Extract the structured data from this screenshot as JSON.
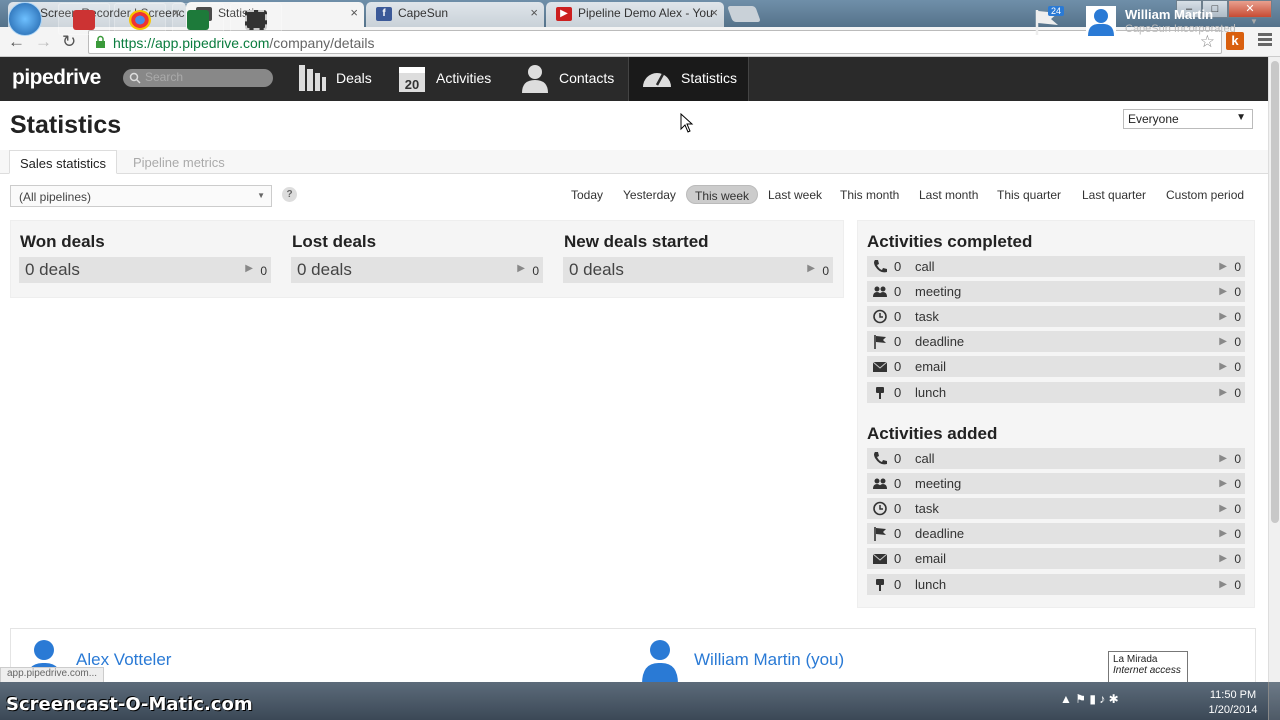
{
  "browser": {
    "tabs": [
      {
        "title": "Screen Recorder | Screenc",
        "favicon": "som-icon",
        "color": "#335577"
      },
      {
        "title": "Statistics",
        "favicon": "pipedrive-icon",
        "color": "#333333"
      },
      {
        "title": "CapeSun",
        "favicon": "facebook-icon",
        "color": "#3b5998"
      },
      {
        "title": "Pipeline Demo Alex - You",
        "favicon": "youtube-icon",
        "color": "#cc1f1f"
      }
    ],
    "url_host": "https://app.pipedrive.com",
    "url_path": "/company/details",
    "extension_letter": "k"
  },
  "app": {
    "logo": "pipedrive",
    "search_placeholder": "Search",
    "nav": [
      {
        "label": "Deals",
        "icon": "deals-icon"
      },
      {
        "label": "Activities",
        "icon": "calendar-icon",
        "badge": "20"
      },
      {
        "label": "Contacts",
        "icon": "contacts-icon"
      },
      {
        "label": "Statistics",
        "icon": "speedometer-icon"
      }
    ],
    "notifications_count": "24",
    "user": {
      "name": "William Martin",
      "company": "CapeSun Incorporated"
    }
  },
  "page": {
    "title": "Statistics",
    "user_filter": "Everyone",
    "tabs": [
      "Sales statistics",
      "Pipeline metrics"
    ],
    "pipeline_select": "(All pipelines)",
    "help": "?",
    "periods": [
      "Today",
      "Yesterday",
      "This week",
      "Last week",
      "This month",
      "Last month",
      "This quarter",
      "Last quarter",
      "Custom period"
    ],
    "active_period": "This week"
  },
  "deal_stats": [
    {
      "title": "Won deals",
      "value": "0 deals",
      "count": "0"
    },
    {
      "title": "Lost deals",
      "value": "0 deals",
      "count": "0"
    },
    {
      "title": "New deals started",
      "value": "0 deals",
      "count": "0"
    }
  ],
  "activities_completed": {
    "title": "Activities completed",
    "rows": [
      {
        "icon": "phone-icon",
        "n": "0",
        "label": "call",
        "count": "0"
      },
      {
        "icon": "meeting-icon",
        "n": "0",
        "label": "meeting",
        "count": "0"
      },
      {
        "icon": "clock-icon",
        "n": "0",
        "label": "task",
        "count": "0"
      },
      {
        "icon": "flag-icon",
        "n": "0",
        "label": "deadline",
        "count": "0"
      },
      {
        "icon": "envelope-icon",
        "n": "0",
        "label": "email",
        "count": "0"
      },
      {
        "icon": "lunch-icon",
        "n": "0",
        "label": "lunch",
        "count": "0"
      }
    ]
  },
  "activities_added": {
    "title": "Activities added",
    "rows": [
      {
        "icon": "phone-icon",
        "n": "0",
        "label": "call",
        "count": "0"
      },
      {
        "icon": "meeting-icon",
        "n": "0",
        "label": "meeting",
        "count": "0"
      },
      {
        "icon": "clock-icon",
        "n": "0",
        "label": "task",
        "count": "0"
      },
      {
        "icon": "flag-icon",
        "n": "0",
        "label": "deadline",
        "count": "0"
      },
      {
        "icon": "envelope-icon",
        "n": "0",
        "label": "email",
        "count": "0"
      },
      {
        "icon": "lunch-icon",
        "n": "0",
        "label": "lunch",
        "count": "0"
      }
    ]
  },
  "users": [
    "Alex Votteler",
    "William Martin (you)"
  ],
  "statusbar": "app.pipedrive.com...",
  "tooltip": {
    "line1": "La Mirada",
    "line2": "Internet access"
  },
  "watermark": "Screencast-O-Matic.com",
  "clock": {
    "time": "11:50 PM",
    "date": "1/20/2014"
  },
  "colors": {
    "accent": "#2a7ad5",
    "header": "#2a2a2a"
  }
}
